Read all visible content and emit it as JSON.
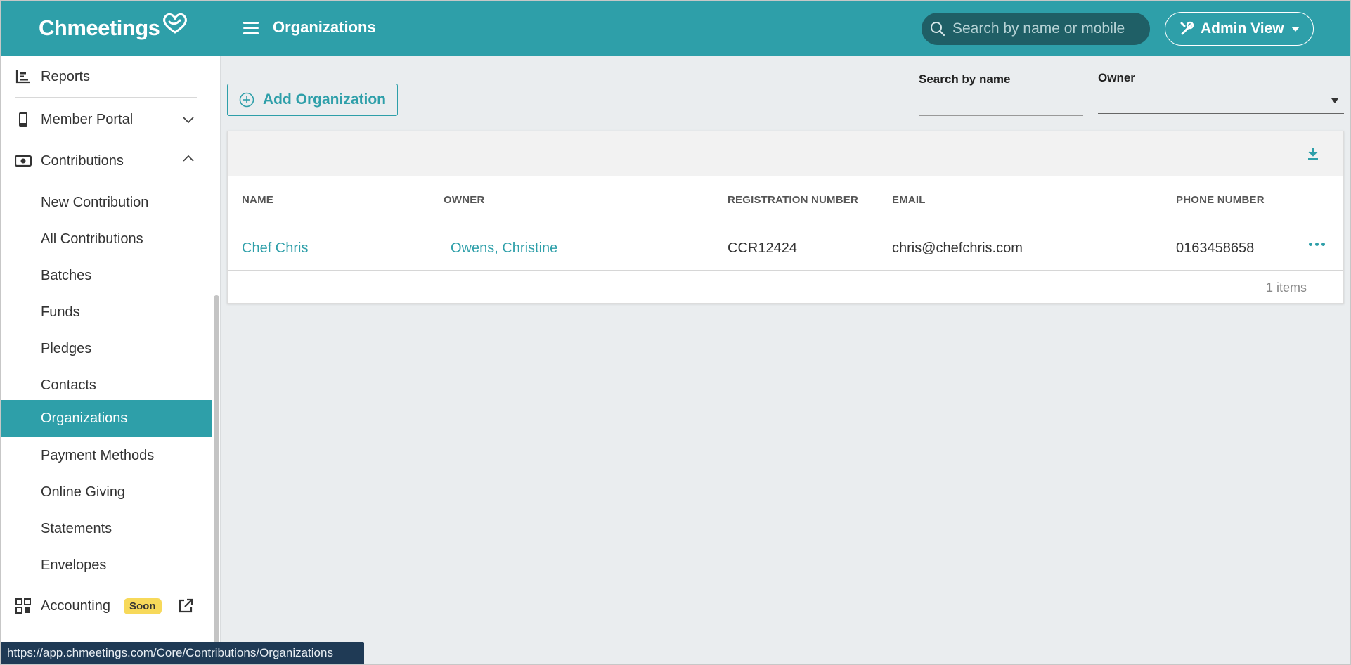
{
  "header": {
    "brand": "Chmeetings",
    "page_title": "Organizations",
    "search_placeholder": "Search by name or mobile",
    "admin_view_label": "Admin View"
  },
  "sidebar": {
    "items": [
      {
        "label": "Reports",
        "icon": "bar-chart-icon"
      },
      {
        "label": "Member Portal",
        "icon": "phone-icon"
      },
      {
        "label": "Contributions",
        "icon": "money-icon"
      },
      {
        "label": "New Contribution"
      },
      {
        "label": "All Contributions"
      },
      {
        "label": "Batches"
      },
      {
        "label": "Funds"
      },
      {
        "label": "Pledges"
      },
      {
        "label": "Contacts"
      },
      {
        "label": "Organizations"
      },
      {
        "label": "Payment Methods"
      },
      {
        "label": "Online Giving"
      },
      {
        "label": "Statements"
      },
      {
        "label": "Envelopes"
      },
      {
        "label": "Accounting",
        "icon": "apps-icon",
        "badge": "Soon"
      }
    ],
    "active_item": "Organizations"
  },
  "main": {
    "add_button_label": "Add Organization",
    "filters": {
      "search_by_name_label": "Search by name",
      "search_by_name_value": "",
      "owner_label": "Owner",
      "owner_value": ""
    },
    "table": {
      "columns": [
        "NAME",
        "OWNER",
        "REGISTRATION NUMBER",
        "EMAIL",
        "PHONE NUMBER"
      ],
      "rows": [
        {
          "name": "Chef Chris",
          "owner": "Owens, Christine",
          "registration_number": "CCR12424",
          "email": "chris@chefchris.com",
          "phone_number": "0163458658"
        }
      ],
      "items_count": "1 items"
    }
  },
  "status_bar": {
    "url": "https://app.chmeetings.com/Core/Contributions/Organizations"
  },
  "colors": {
    "accent": "#2e9fa9",
    "search_bg": "#1f5f66",
    "badge": "#f7d95a",
    "background": "#eaedef"
  }
}
